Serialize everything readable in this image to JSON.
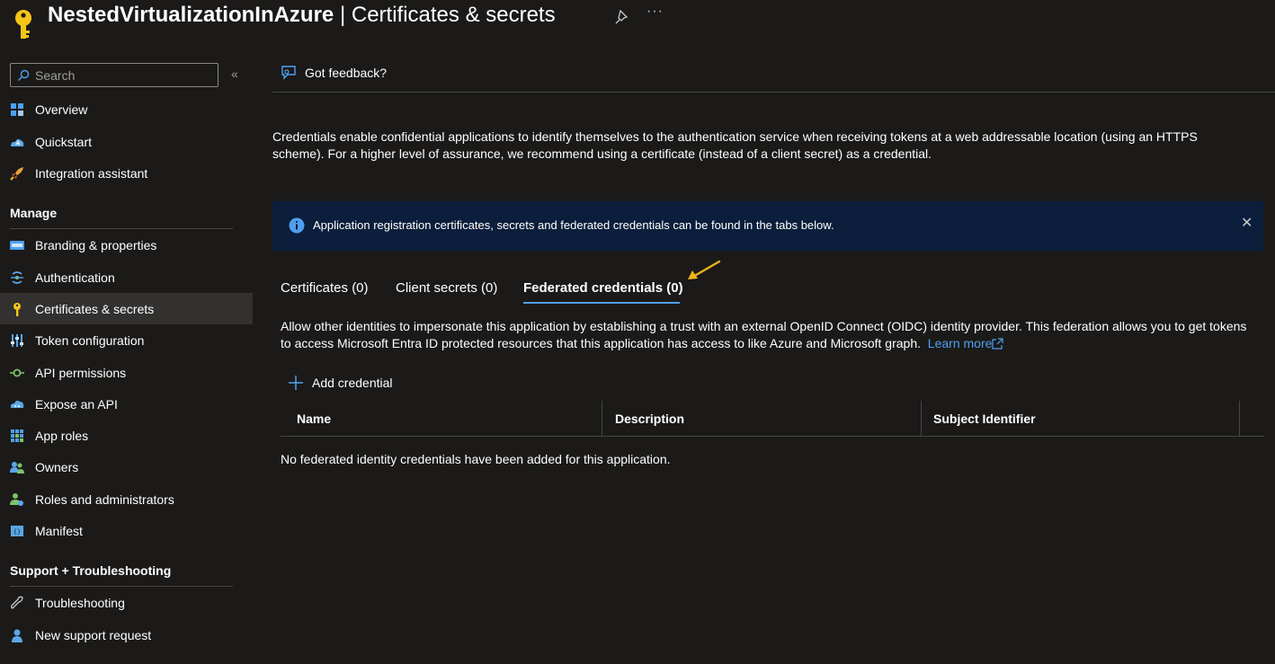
{
  "header": {
    "app_name": "NestedVirtualizationInAzure",
    "separator": "|",
    "page_name": "Certificates & secrets",
    "more": "···"
  },
  "sidebar": {
    "search_placeholder": "Search",
    "collapse": "«",
    "top_items": [
      {
        "label": "Overview",
        "icon": "overview-icon"
      },
      {
        "label": "Quickstart",
        "icon": "quickstart-icon"
      },
      {
        "label": "Integration assistant",
        "icon": "rocket-icon"
      }
    ],
    "manage_title": "Manage",
    "manage_items": [
      {
        "label": "Branding & properties",
        "icon": "branding-icon"
      },
      {
        "label": "Authentication",
        "icon": "authentication-icon"
      },
      {
        "label": "Certificates & secrets",
        "icon": "key-icon",
        "active": true
      },
      {
        "label": "Token configuration",
        "icon": "token-config-icon"
      },
      {
        "label": "API permissions",
        "icon": "api-permissions-icon"
      },
      {
        "label": "Expose an API",
        "icon": "cloud-api-icon"
      },
      {
        "label": "App roles",
        "icon": "app-roles-icon"
      },
      {
        "label": "Owners",
        "icon": "owners-icon"
      },
      {
        "label": "Roles and administrators",
        "icon": "roles-admin-icon"
      },
      {
        "label": "Manifest",
        "icon": "manifest-icon"
      }
    ],
    "support_title": "Support + Troubleshooting",
    "support_items": [
      {
        "label": "Troubleshooting",
        "icon": "wrench-icon"
      },
      {
        "label": "New support request",
        "icon": "support-person-icon"
      }
    ]
  },
  "main": {
    "feedback_label": "Got feedback?",
    "intro_text": "Credentials enable confidential applications to identify themselves to the authentication service when receiving tokens at a web addressable location (using an HTTPS scheme). For a higher level of assurance, we recommend using a certificate (instead of a client secret) as a credential.",
    "banner_text": "Application registration certificates, secrets and federated credentials can be found in the tabs below.",
    "banner_close": "✕",
    "tabs": [
      {
        "label": "Certificates (0)"
      },
      {
        "label": "Client secrets (0)"
      },
      {
        "label": "Federated credentials (0)",
        "active": true
      }
    ],
    "fed_description": "Allow other identities to impersonate this application by establishing a trust with an external OpenID Connect (OIDC) identity provider. This federation allows you to get tokens to access Microsoft Entra ID protected resources that this application has access to like Azure and Microsoft graph.",
    "learn_more": "Learn more",
    "add_credential_label": "Add credential",
    "table": {
      "columns": [
        "Name",
        "Description",
        "Subject Identifier"
      ],
      "empty_message": "No federated identity credentials have been added for this application."
    }
  },
  "colors": {
    "background": "#1b1a19",
    "accent": "#4f9ff0",
    "banner_bg": "#0b1e3b",
    "key_yellow": "#f5c518",
    "arrow_yellow": "#f0b31b"
  }
}
